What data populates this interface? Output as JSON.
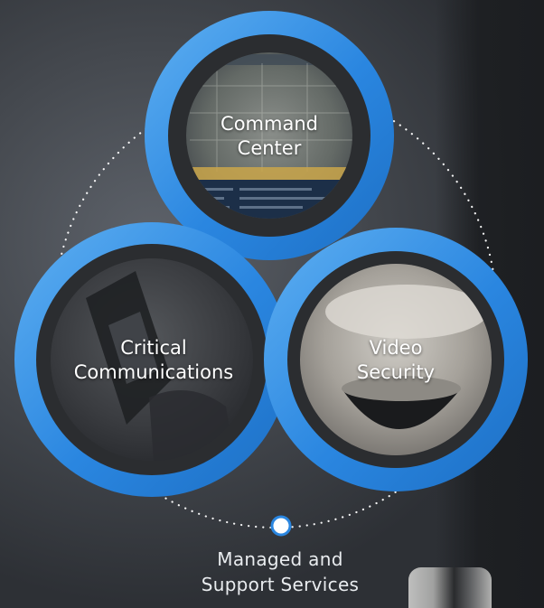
{
  "nodes": [
    {
      "id": "command-center",
      "lines": [
        "Command",
        "Center"
      ]
    },
    {
      "id": "critical-communications",
      "lines": [
        "Critical",
        "Communications"
      ]
    },
    {
      "id": "video-security",
      "lines": [
        "Video",
        "Security"
      ]
    }
  ],
  "footer": {
    "lines": [
      "Managed and",
      "Support Services"
    ]
  },
  "colors": {
    "ring_blue": "#2a86e0",
    "ring_blue_light": "#55a6ee",
    "inner_dark": "#2b2d30",
    "dots": "#ffffff",
    "footer_dot_border": "#2a86e0"
  }
}
